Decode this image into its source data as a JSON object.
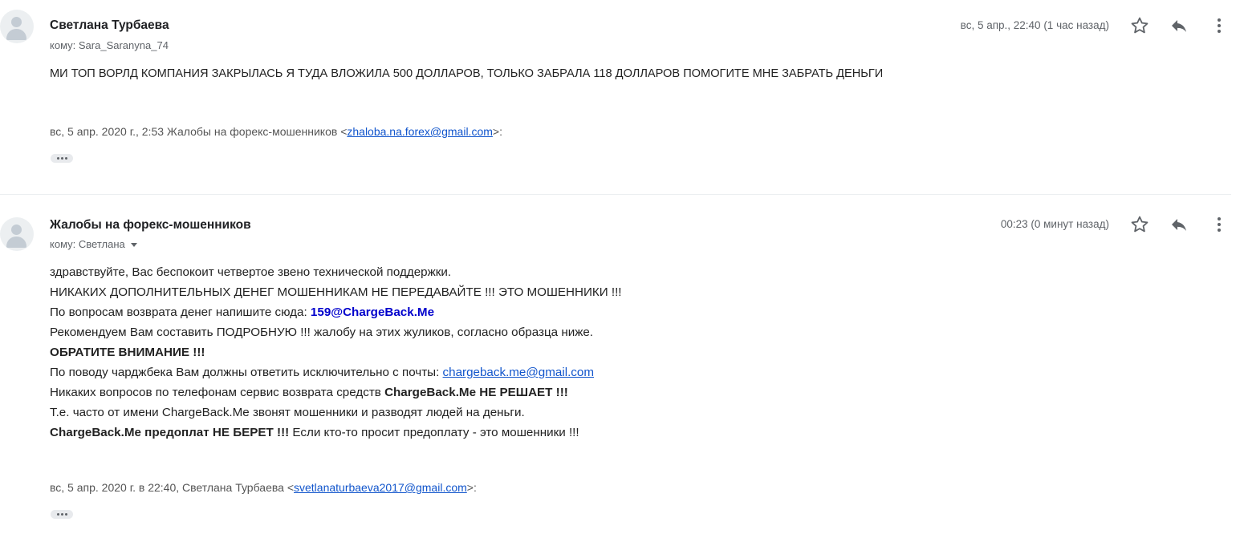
{
  "messages": [
    {
      "sender": "Светлана Турбаева",
      "to_label": "кому:",
      "to": "Sara_Saranyna_74",
      "date": "вс, 5 апр., 22:40 (1 час назад)",
      "body": "МИ ТОП ВОРЛД КОМПАНИЯ  ЗАКРЫЛАСЬ Я ТУДА ВЛОЖИЛА 500 ДОЛЛАРОВ, ТОЛЬКО ЗАБРАЛА 118 ДОЛЛАРОВ ПОМОГИТЕ МНЕ ЗАБРАТЬ ДЕНЬГИ",
      "quote_prefix": "вс, 5 апр. 2020 г., 2:53 Жалобы на форекс-мошенников <",
      "quote_email": "zhaloba.na.forex@gmail.com",
      "quote_suffix": ">:"
    },
    {
      "sender": "Жалобы на форекс-мошенников",
      "to_label": "кому:",
      "to": "Светлана",
      "date": "00:23 (0 минут назад)",
      "lines": {
        "l1": "здравствуйте, Вас беспокоит четвертое звено технической поддержки.",
        "l2": "НИКАКИХ ДОПОЛНИТЕЛЬНЫХ ДЕНЕГ МОШЕННИКАМ НЕ ПЕРЕДАВАЙТЕ !!! ЭТО МОШЕННИКИ !!!",
        "l3a": "По вопросам возврата денег напишите сюда: ",
        "l3b": "159@ChargeBack.Me",
        "l4": "Рекомендуем Вам составить ПОДРОБНУЮ !!! жалобу на этих жуликов, согласно образца ниже.",
        "l5": "ОБРАТИТЕ ВНИМАНИЕ !!!",
        "l6a": "По поводу чарджбека Вам должны ответить исключительно с почты: ",
        "l6b": "chargeback.me@gmail.com",
        "l7a": "Никаких вопросов по телефонам сервис возврата средств ",
        "l7b": "ChargeBack.Me НЕ РЕШАЕТ !!!",
        "l8": "Т.е. часто от имени ChargeBack.Me звонят мошенники и разводят людей на деньги.",
        "l9a": "ChargeBack.Me предоплат НЕ БЕРЕТ !!!",
        "l9b": " Если кто-то просит предоплату - это мошенники !!!"
      },
      "quote_prefix": "вс, 5 апр. 2020 г. в 22:40, Светлана Турбаева <",
      "quote_email": "svetlanaturbaeva2017@gmail.com",
      "quote_suffix": ">:"
    }
  ],
  "icons": {
    "star": "star-icon",
    "reply": "reply-icon",
    "more": "more-vert-icon",
    "avatar": "avatar-icon"
  },
  "colors": {
    "link": "#1155cc",
    "bold_blue": "#0000cc",
    "meta": "#5f6368"
  }
}
